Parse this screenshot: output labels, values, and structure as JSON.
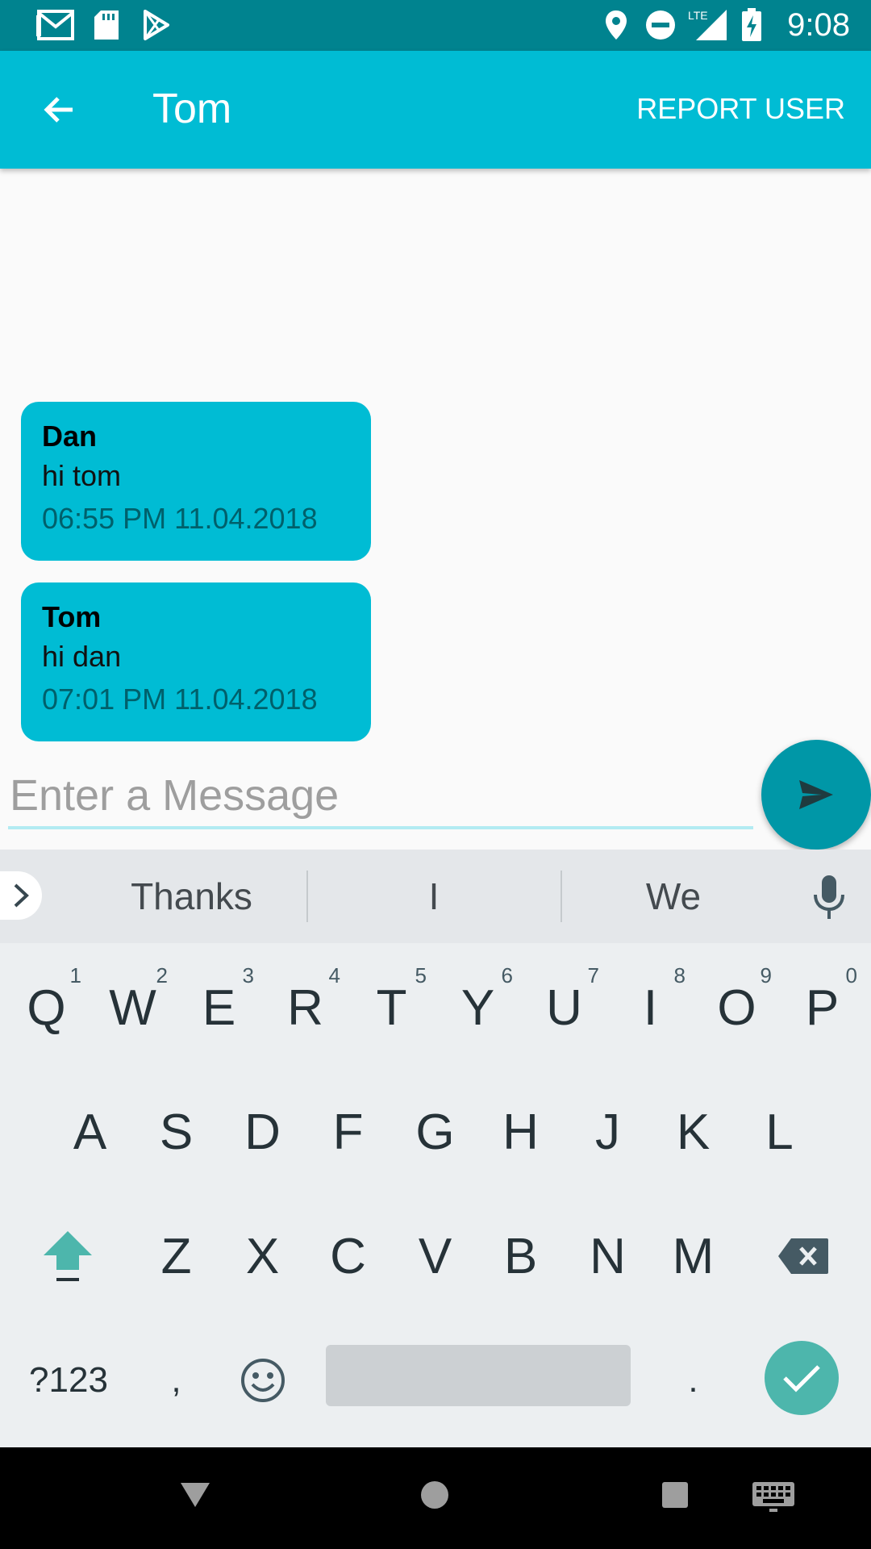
{
  "status_bar": {
    "time": "9:08",
    "network": "LTE",
    "icons": [
      "gmail-icon",
      "sd-card-icon",
      "play-store-icon",
      "location-icon",
      "do-not-disturb-icon",
      "signal-icon",
      "battery-charging-icon"
    ]
  },
  "app_bar": {
    "title": "Tom",
    "action": "REPORT USER",
    "back_icon": "arrow-back-icon"
  },
  "messages": [
    {
      "sender": "Dan",
      "text": "hi tom",
      "time": "06:55 PM 11.04.2018"
    },
    {
      "sender": "Tom",
      "text": "hi dan",
      "time": "07:01 PM 11.04.2018"
    }
  ],
  "composer": {
    "placeholder": "Enter a Message",
    "value": "",
    "send_icon": "send-icon"
  },
  "keyboard": {
    "suggestions": [
      "Thanks",
      "I",
      "We"
    ],
    "row1": [
      "Q",
      "W",
      "E",
      "R",
      "T",
      "Y",
      "U",
      "I",
      "O",
      "P"
    ],
    "row1_hints": [
      "1",
      "2",
      "3",
      "4",
      "5",
      "6",
      "7",
      "8",
      "9",
      "0"
    ],
    "row2": [
      "A",
      "S",
      "D",
      "F",
      "G",
      "H",
      "J",
      "K",
      "L"
    ],
    "row3": [
      "Z",
      "X",
      "C",
      "V",
      "B",
      "N",
      "M"
    ],
    "symbols_label": "?123",
    "comma": ",",
    "period": "."
  },
  "colors": {
    "status_bar": "#00838f",
    "app_bar": "#00bcd4",
    "bubble": "#00bcd4",
    "send_button": "#0097a7",
    "keyboard_accent": "#4db6ac"
  }
}
